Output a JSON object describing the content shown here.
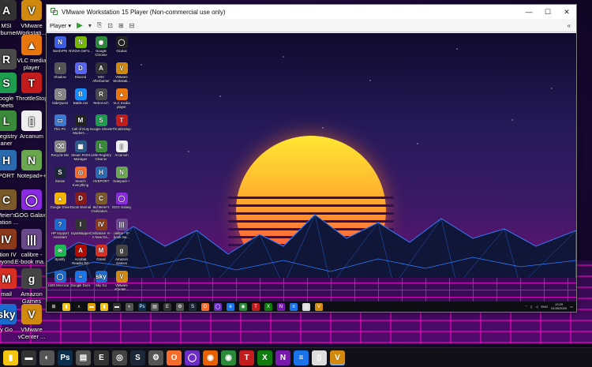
{
  "host": {
    "desktop_icons": [
      {
        "label": "MSI Afterburner",
        "display": "MSI\nurburner",
        "glyph": "A",
        "color": "#333"
      },
      {
        "label": "VMware Workstation",
        "display": "VMware\nWorkstati...",
        "glyph": "V",
        "color": "#d08a10"
      },
      {
        "label": "RetroArch",
        "display": "oArch",
        "glyph": "R",
        "color": "#4a4a4a"
      },
      {
        "label": "VLC media player",
        "display": "VLC media\nplayer",
        "glyph": "▲",
        "color": "#e8760c"
      },
      {
        "label": "Google Sheets",
        "display": "oogle\nheets",
        "glyph": "S",
        "color": "#1e9d4f"
      },
      {
        "label": "ThrottleStop",
        "display": "ThrottleStop",
        "glyph": "T",
        "color": "#c21c1c"
      },
      {
        "label": "Little Registry Cleaner",
        "display": "Registry\naner",
        "glyph": "L",
        "color": "#3b8a3b"
      },
      {
        "label": "Arcanum",
        "display": "Arcanum",
        "glyph": "▯",
        "color": "#eee"
      },
      {
        "label": "HVEPORT",
        "display": "PORT",
        "glyph": "H",
        "color": "#2a6bb0"
      },
      {
        "label": "Notepad++",
        "display": "Notepad++",
        "glyph": "N",
        "color": "#6aa84f"
      },
      {
        "label": "Sid Meier's Civilization",
        "display": "Meier's\nization ...",
        "glyph": "C",
        "color": "#7a5a2a"
      },
      {
        "label": "GOG Galaxy",
        "display": "GOG Galaxy",
        "glyph": "◯",
        "color": "#8a2be2"
      },
      {
        "label": "Civilization IV",
        "display": "ation IV\nBeyond...",
        "glyph": "IV",
        "color": "#8a3a1a"
      },
      {
        "label": "calibre - E-book management",
        "display": "calibre -\nE-book ma...",
        "glyph": "|||",
        "color": "#6a4a8a"
      },
      {
        "label": "Gmail",
        "display": "mail",
        "glyph": "M",
        "color": "#d93025"
      },
      {
        "label": "Amazon Games",
        "display": "Amazon\nGames",
        "glyph": "g",
        "color": "#444"
      },
      {
        "label": "Sky Go",
        "display": "y Go",
        "glyph": "sky",
        "color": "#1a6ad0"
      },
      {
        "label": "VMware vCenter",
        "display": "VMware\nvCenter ...",
        "glyph": "V",
        "color": "#d08a10"
      }
    ],
    "taskbar_icons": [
      {
        "name": "notes",
        "glyph": "▮",
        "color": "#f1c40f"
      },
      {
        "name": "terminal",
        "glyph": "▬",
        "color": "#333"
      },
      {
        "name": "speed",
        "glyph": "◐",
        "color": "#555"
      },
      {
        "name": "photoshop",
        "glyph": "Ps",
        "color": "#0b2f4f"
      },
      {
        "name": "files",
        "glyph": "▤",
        "color": "#555"
      },
      {
        "name": "epic",
        "glyph": "E",
        "color": "#333"
      },
      {
        "name": "app",
        "glyph": "◎",
        "color": "#444"
      },
      {
        "name": "steam",
        "glyph": "S",
        "color": "#1b2838"
      },
      {
        "name": "settings",
        "glyph": "⚙",
        "color": "#555"
      },
      {
        "name": "origin",
        "glyph": "O",
        "color": "#f56c2d"
      },
      {
        "name": "gog",
        "glyph": "◯",
        "color": "#6b2dc4"
      },
      {
        "name": "firefox",
        "glyph": "◉",
        "color": "#e66000"
      },
      {
        "name": "chrome",
        "glyph": "◉",
        "color": "#2a8a3a"
      },
      {
        "name": "throttle",
        "glyph": "T",
        "color": "#c21c1c"
      },
      {
        "name": "xbox",
        "glyph": "X",
        "color": "#107c10"
      },
      {
        "name": "onenote",
        "glyph": "N",
        "color": "#7719aa"
      },
      {
        "name": "docs",
        "glyph": "≡",
        "color": "#1a73e8"
      },
      {
        "name": "document",
        "glyph": "▯",
        "color": "#ddd"
      },
      {
        "name": "vmware",
        "glyph": "V",
        "color": "#d08a10"
      }
    ]
  },
  "vmware": {
    "title": "VMware Workstation 15 Player (Non-commercial use only)",
    "toolbar": {
      "player_label": "Player ▾",
      "play_glyph": "▶",
      "dropdown_glyph": "▾",
      "send_ctrl_alt_del": "⎘",
      "fit_guest": "⊡",
      "fullscreen": "⊞",
      "unity": "⊟",
      "close_glyph": "«"
    },
    "window_buttons": {
      "minimize": "—",
      "maximize": "☐",
      "close": "✕"
    }
  },
  "guest": {
    "desktop_icons": [
      {
        "label": "NordVPN",
        "glyph": "N",
        "color": "#3e5fe3"
      },
      {
        "label": "NVIDIA GeFo...",
        "glyph": "N",
        "color": "#76b900"
      },
      {
        "label": "Google Chrome",
        "glyph": "◉",
        "color": "#2a8a3a"
      },
      {
        "label": "Oculus",
        "glyph": "◯",
        "color": "#222"
      },
      {
        "label": "Shadow",
        "glyph": "◐",
        "color": "#555"
      },
      {
        "label": "Discord",
        "glyph": "D",
        "color": "#5865f2"
      },
      {
        "label": "MSI Afterburner",
        "glyph": "A",
        "color": "#333"
      },
      {
        "label": "VMware Workstati...",
        "glyph": "V",
        "color": "#d08a10"
      },
      {
        "label": "SideQuest",
        "glyph": "S",
        "color": "#888"
      },
      {
        "label": "Battle.net",
        "glyph": "B",
        "color": "#148eff"
      },
      {
        "label": "RetroArch",
        "glyph": "R",
        "color": "#4a4a4a"
      },
      {
        "label": "VLC media player",
        "glyph": "▲",
        "color": "#e8760c"
      },
      {
        "label": "This PC",
        "glyph": "▭",
        "color": "#3a7ad0"
      },
      {
        "label": "Call of Duty Modern ...",
        "glyph": "M",
        "color": "#222"
      },
      {
        "label": "Google Sheets",
        "glyph": "S",
        "color": "#1e9d4f"
      },
      {
        "label": "ThrottleStop",
        "glyph": "T",
        "color": "#c21c1c"
      },
      {
        "label": "Recycle Bin",
        "glyph": "⌫",
        "color": "#888"
      },
      {
        "label": "Steam ROM Manager",
        "glyph": "▦",
        "color": "#2a5a8a"
      },
      {
        "label": "Little Registry Cleaner",
        "glyph": "L",
        "color": "#3b8a3b"
      },
      {
        "label": "Arcanum",
        "glyph": "▯",
        "color": "#eee"
      },
      {
        "label": "Steam",
        "glyph": "S",
        "color": "#1b2838"
      },
      {
        "label": "Search Everything",
        "glyph": "◎",
        "color": "#f56c2d"
      },
      {
        "label": "HVEPORT",
        "glyph": "H",
        "color": "#2a6bb0"
      },
      {
        "label": "Notepad++",
        "glyph": "N",
        "color": "#6aa84f"
      },
      {
        "label": "Google Drive",
        "glyph": "▲",
        "color": "#f4b400"
      },
      {
        "label": "Doom Eternal",
        "glyph": "D",
        "color": "#8a1a1a"
      },
      {
        "label": "Sid Meier's Civilization ...",
        "glyph": "C",
        "color": "#7a5a2a"
      },
      {
        "label": "GOG Galaxy",
        "glyph": "◯",
        "color": "#8a2be2"
      },
      {
        "label": "HP Support Assistant",
        "glyph": "?",
        "color": "#1a6ad0"
      },
      {
        "label": "InputMapper",
        "glyph": "I",
        "color": "#333"
      },
      {
        "label": "Civilization IV - A New Da...",
        "glyph": "IV",
        "color": "#8a3a1a"
      },
      {
        "label": "calibre - E-book ma...",
        "glyph": "|||",
        "color": "#6a4a8a"
      },
      {
        "label": "Spotify",
        "glyph": "≋",
        "color": "#1db954"
      },
      {
        "label": "Acrobat Reader DC",
        "glyph": "A",
        "color": "#b30b00"
      },
      {
        "label": "Gmail",
        "glyph": "M",
        "color": "#d93025"
      },
      {
        "label": "Amazon Games",
        "glyph": "g",
        "color": "#444"
      },
      {
        "label": "LWS Microcor...",
        "glyph": "◯",
        "color": "#1a6ad0"
      },
      {
        "label": "Google Docs",
        "glyph": "≡",
        "color": "#1a73e8"
      },
      {
        "label": "Sky Go",
        "glyph": "sky",
        "color": "#1a6ad0"
      },
      {
        "label": "VMware vCenter...",
        "glyph": "V",
        "color": "#d08a10"
      }
    ],
    "taskbar_icons": [
      {
        "name": "start",
        "glyph": "⊞",
        "color": "#111"
      },
      {
        "name": "note",
        "glyph": "▮",
        "color": "#f1c40f"
      },
      {
        "name": "search",
        "glyph": "⌕",
        "color": "#111"
      },
      {
        "name": "explorer",
        "glyph": "▬",
        "color": "#e0a000"
      },
      {
        "name": "notes",
        "glyph": "▮",
        "color": "#f1c40f"
      },
      {
        "name": "terminal",
        "glyph": "▬",
        "color": "#333"
      },
      {
        "name": "app",
        "glyph": "◐",
        "color": "#555"
      },
      {
        "name": "photoshop",
        "glyph": "Ps",
        "color": "#0b2f4f"
      },
      {
        "name": "files",
        "glyph": "▤",
        "color": "#555"
      },
      {
        "name": "epic",
        "glyph": "E",
        "color": "#333"
      },
      {
        "name": "settings",
        "glyph": "⚙",
        "color": "#555"
      },
      {
        "name": "steam",
        "glyph": "S",
        "color": "#1b2838"
      },
      {
        "name": "origin",
        "glyph": "O",
        "color": "#f56c2d"
      },
      {
        "name": "gog",
        "glyph": "◯",
        "color": "#6b2dc4"
      },
      {
        "name": "edge",
        "glyph": "e",
        "color": "#1a73e8"
      },
      {
        "name": "chrome",
        "glyph": "◉",
        "color": "#2a8a3a"
      },
      {
        "name": "throttle",
        "glyph": "T",
        "color": "#c21c1c"
      },
      {
        "name": "xbox",
        "glyph": "X",
        "color": "#107c10"
      },
      {
        "name": "onenote",
        "glyph": "N",
        "color": "#7719aa"
      },
      {
        "name": "docs",
        "glyph": "≡",
        "color": "#1a73e8"
      },
      {
        "name": "document",
        "glyph": "▯",
        "color": "#ddd"
      },
      {
        "name": "vmware",
        "glyph": "V",
        "color": "#d08a10"
      }
    ],
    "tray": {
      "language": "ENG",
      "time": "13:29",
      "date": "01/05/2020"
    }
  }
}
